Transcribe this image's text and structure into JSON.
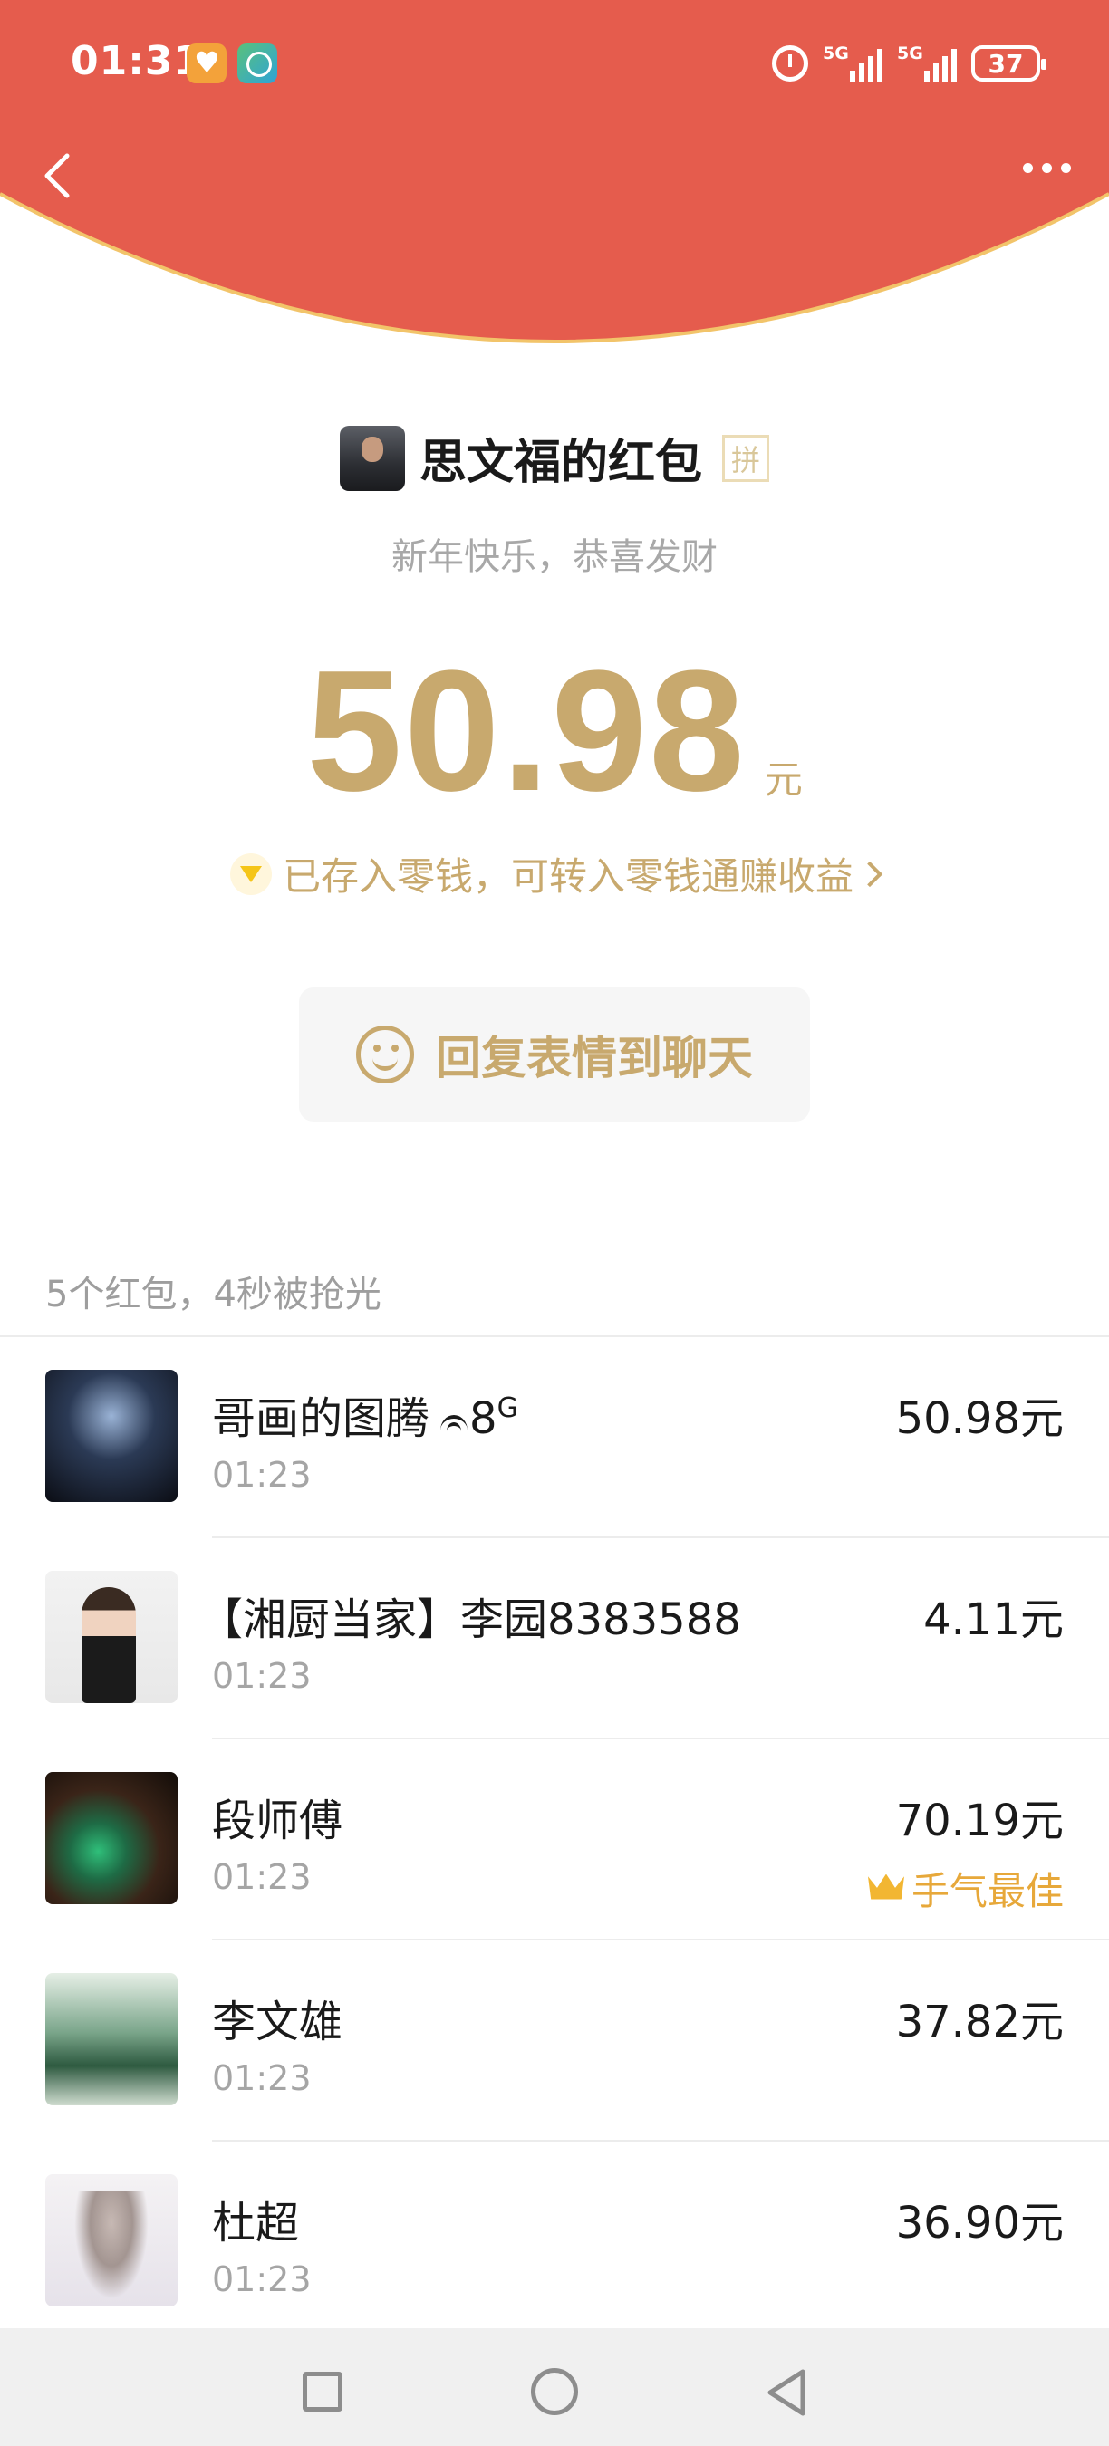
{
  "status_bar": {
    "time": "01:31",
    "network_1": "5G",
    "network_2": "5G",
    "battery": "37",
    "icons": [
      "heart-app-icon",
      "wifi-app-icon",
      "alarm-icon",
      "signal-icon",
      "signal-icon",
      "battery-icon"
    ]
  },
  "header": {
    "back_icon": "chevron-left-icon",
    "more_icon": "ellipsis-icon",
    "color": "#e55c4d"
  },
  "sender": {
    "name": "思文福的红包",
    "pin_badge": "拼",
    "wish": "新年快乐，恭喜发财"
  },
  "received": {
    "amount": "50.98",
    "unit": "元",
    "stored_note": "已存入零钱，可转入零钱通赚收益",
    "accent": "#c8a96e"
  },
  "reply_button": {
    "label": "回复表情到聊天"
  },
  "summary": "5个红包，4秒被抢光",
  "recipients": [
    {
      "name": "哥画的图腾",
      "name_suffix": "8",
      "name_sup": "G",
      "time": "01:23",
      "amount": "50.98元",
      "best": ""
    },
    {
      "name": "【湘厨当家】李园8383588",
      "name_suffix": "",
      "name_sup": "",
      "time": "01:23",
      "amount": "4.11元",
      "best": ""
    },
    {
      "name": "段师傅",
      "name_suffix": "",
      "name_sup": "",
      "time": "01:23",
      "amount": "70.19元",
      "best": "手气最佳"
    },
    {
      "name": "李文雄",
      "name_suffix": "",
      "name_sup": "",
      "time": "01:23",
      "amount": "37.82元",
      "best": ""
    },
    {
      "name": "杜超",
      "name_suffix": "",
      "name_sup": "",
      "time": "01:23",
      "amount": "36.90元",
      "best": ""
    }
  ],
  "nav_bar": {
    "icons": [
      "recents-square-icon",
      "home-circle-icon",
      "back-triangle-icon"
    ]
  }
}
